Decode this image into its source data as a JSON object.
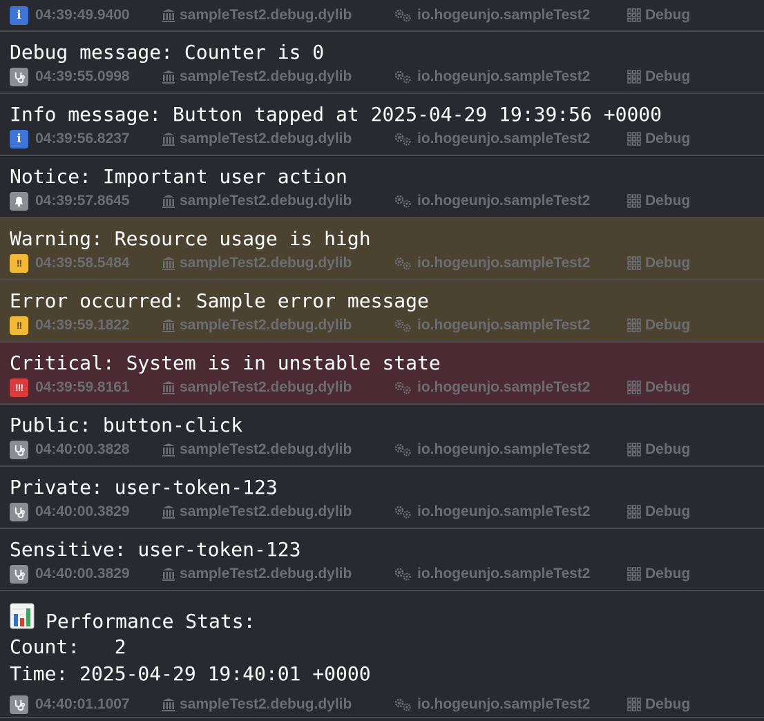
{
  "console": {
    "library": "sampleTest2.debug.dylib",
    "subsystem": "io.hogeunjo.sampleTest2",
    "category": "Debug",
    "icons": {
      "library": "building-columns-icon",
      "subsystem": "gears-icon",
      "category": "grid-icon",
      "info": "info-icon",
      "debug": "stethoscope-icon",
      "notice": "bell-icon",
      "warning": "double-exclamation-icon",
      "critical": "triple-exclamation-icon"
    },
    "colors": {
      "background": "#292a30",
      "warning_row": "#4b4230",
      "critical_row": "#4b2a34",
      "info_badge": "#3f73d8",
      "debug_badge": "#8c8d93",
      "warning_badge": "#f1b937",
      "critical_badge": "#d93c3c"
    },
    "entries": [
      {
        "level": "info",
        "message": "",
        "timestamp": "04:39:49.9400"
      },
      {
        "level": "debug",
        "message": "Debug message: Counter is 0",
        "timestamp": "04:39:55.0998"
      },
      {
        "level": "info",
        "message": "Info message: Button tapped at 2025-04-29 19:39:56 +0000",
        "timestamp": "04:39:56.8237"
      },
      {
        "level": "notice",
        "message": "Notice: Important user action",
        "timestamp": "04:39:57.8645"
      },
      {
        "level": "warning",
        "message": "Warning: Resource usage is high",
        "timestamp": "04:39:58.5484"
      },
      {
        "level": "warning",
        "message": "Error occurred: Sample error message",
        "timestamp": "04:39:59.1822"
      },
      {
        "level": "critical",
        "message": "Critical: System is in unstable state",
        "timestamp": "04:39:59.8161"
      },
      {
        "level": "debug",
        "message": "Public: button-click",
        "timestamp": "04:40:00.3828"
      },
      {
        "level": "debug",
        "message": "Private: user-token-123",
        "timestamp": "04:40:00.3829"
      },
      {
        "level": "debug",
        "message": "Sensitive: user-token-123",
        "timestamp": "04:40:00.3829"
      }
    ],
    "stats_entry": {
      "level": "debug",
      "lines": [
        "Performance Stats:",
        "Count:   2",
        "Time: 2025-04-29 19:40:01 +0000"
      ],
      "emoji_icon": "bar-chart-emoji-icon",
      "timestamp": "04:40:01.1007"
    }
  }
}
